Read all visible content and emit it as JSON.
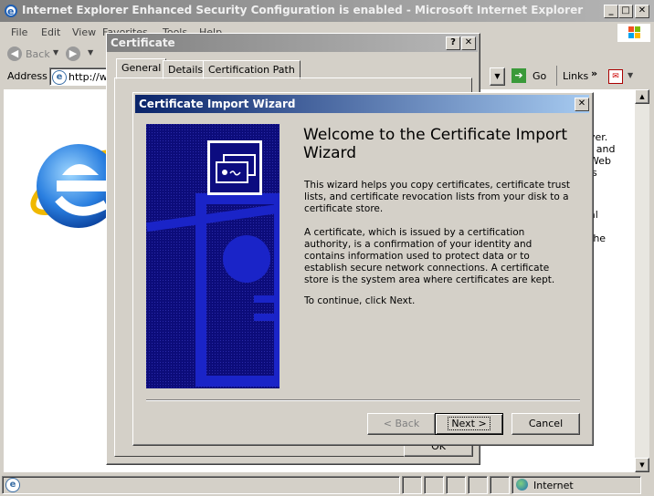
{
  "ie": {
    "title": "Internet Explorer Enhanced Security Configuration is enabled - Microsoft Internet Explorer",
    "menu": [
      "File",
      "Edit",
      "View",
      "Favorites",
      "Tools",
      "Help"
    ],
    "back_label": "Back",
    "address_label": "Address",
    "address_value": "http://w",
    "go_label": "Go",
    "links_label": "Links",
    "content_fragments": [
      "l",
      "ver.",
      "t and",
      "Web",
      "is",
      "al",
      "the"
    ],
    "status_zone": "Internet"
  },
  "cert": {
    "title": "Certificate",
    "tabs": [
      "General",
      "Details",
      "Certification Path"
    ],
    "ok_label": "OK"
  },
  "wizard": {
    "title": "Certificate Import Wizard",
    "heading": "Welcome to the Certificate Import Wizard",
    "para1": "This wizard helps you copy certificates, certificate trust lists, and certificate revocation lists from your disk to a certificate store.",
    "para2": "A certificate, which is issued by a certification authority, is a confirmation of your identity and contains information used to protect data or to establish secure network connections. A certificate store is the system area where certificates are kept.",
    "para3": "To continue, click Next.",
    "back_label": "< Back",
    "next_label": "Next >",
    "cancel_label": "Cancel"
  }
}
